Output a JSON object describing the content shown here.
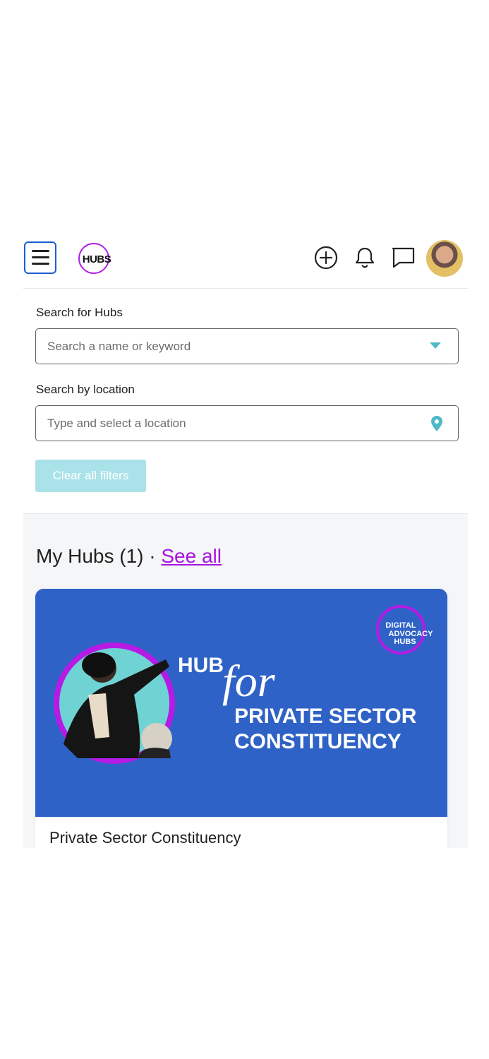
{
  "topbar": {
    "logo_text": "HUBS",
    "icons": [
      "menu-icon",
      "plus-circle-icon",
      "bell-icon",
      "chat-icon",
      "avatar"
    ],
    "accent": "#b11ce8"
  },
  "search": {
    "hubs_label": "Search for Hubs",
    "hubs_placeholder": "Search a name or keyword",
    "location_label": "Search by location",
    "location_placeholder": "Type and select a location",
    "clear_label": "Clear all filters"
  },
  "my_hubs": {
    "title": "My Hubs (1) · ",
    "see_all": "See all",
    "cards": [
      {
        "title": "Private Sector Constituency",
        "banner": {
          "hub": "HUB",
          "for": "for",
          "line1": "PRIVATE SECTOR",
          "line2": "CONSTITUENCY",
          "badge_line1": "DIGITAL",
          "badge_line2": "ADVOCACY",
          "badge_line3": "HUBS",
          "color": "#2f62c6"
        }
      }
    ]
  }
}
